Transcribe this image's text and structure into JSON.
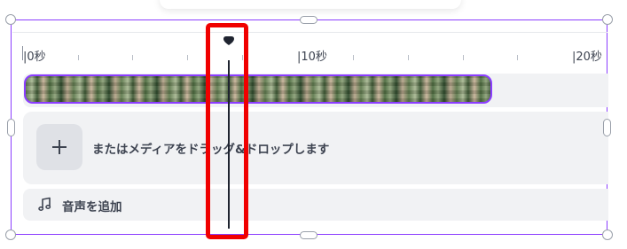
{
  "ruler": {
    "labels": [
      "|0秒",
      "|10秒",
      "|20秒"
    ]
  },
  "timeline": {
    "drop_text": "またはメディアをドラッグ&ドロップします",
    "audio_label": "音声を追加"
  },
  "colors": {
    "accent": "#8b3dff",
    "highlight": "#f00000",
    "track_bg": "#f1f2f4"
  },
  "icons": {
    "add_media": "plus-icon",
    "audio": "music-note-icon",
    "playhead": "playhead-marker-icon"
  }
}
